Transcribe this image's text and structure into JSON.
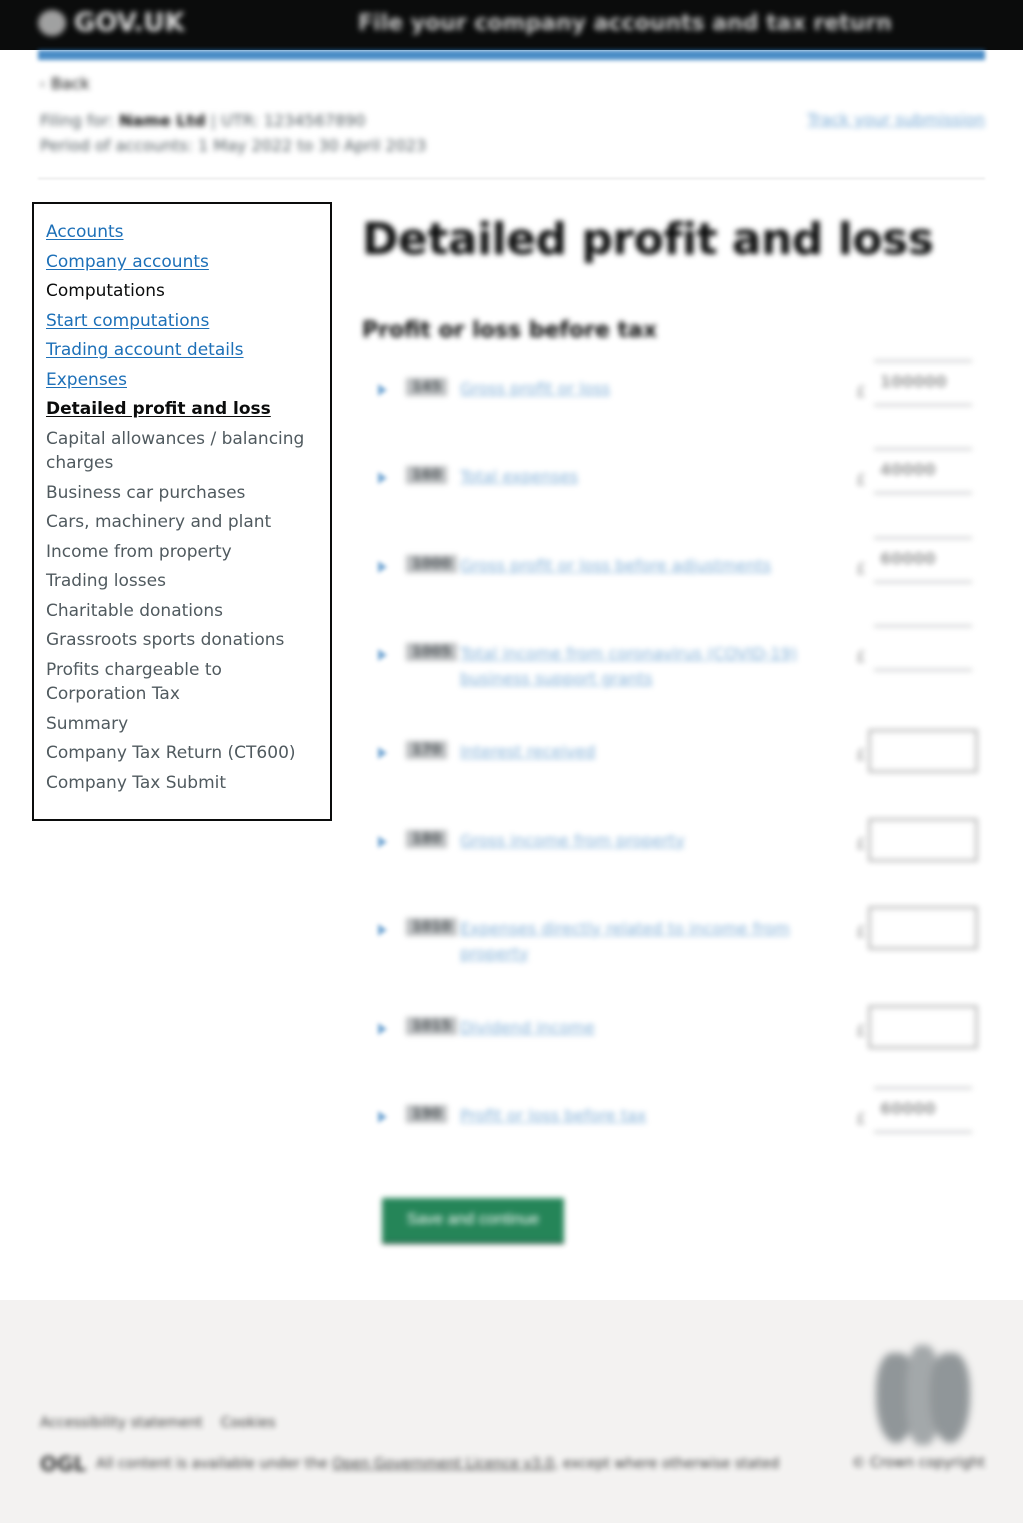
{
  "header": {
    "logo_text": "GOV.UK",
    "service_name": "File your company accounts and tax return"
  },
  "back_link": "Back",
  "meta": {
    "filing_for_label": "Filing for:",
    "company_name": "Name Ltd",
    "utr": "| UTR: 1234567890",
    "period": "Period of accounts: 1 May 2022 to 30 April 2023",
    "track_link": "Track your submission"
  },
  "sidebar": {
    "items": [
      {
        "label": "Accounts",
        "type": "link"
      },
      {
        "label": "Company accounts",
        "type": "link"
      },
      {
        "label": "Computations",
        "type": "heading"
      },
      {
        "label": "Start computations",
        "type": "link"
      },
      {
        "label": "Trading account details",
        "type": "link"
      },
      {
        "label": "Expenses",
        "type": "link"
      },
      {
        "label": "Detailed profit and loss",
        "type": "current"
      },
      {
        "label": "Capital allowances / balancing charges",
        "type": "disabled"
      },
      {
        "label": "Business car purchases",
        "type": "disabled"
      },
      {
        "label": "Cars, machinery and plant",
        "type": "disabled"
      },
      {
        "label": "Income from property",
        "type": "disabled"
      },
      {
        "label": "Trading losses",
        "type": "disabled"
      },
      {
        "label": "Charitable donations",
        "type": "disabled"
      },
      {
        "label": "Grassroots sports donations",
        "type": "disabled"
      },
      {
        "label": "Profits chargeable to Corporation Tax",
        "type": "disabled"
      },
      {
        "label": "Summary",
        "type": "disabled"
      },
      {
        "label": "Company Tax Return (CT600)",
        "type": "disabled"
      },
      {
        "label": "Company Tax Submit",
        "type": "disabled"
      }
    ]
  },
  "main": {
    "title": "Detailed profit and loss",
    "section_title": "Profit or loss before tax",
    "currency": "£",
    "rows": [
      {
        "box": "145",
        "label": "Gross profit or loss",
        "kind": "readonly",
        "value": "100000"
      },
      {
        "box": "160",
        "label": "Total expenses",
        "kind": "readonly",
        "value": "40000"
      },
      {
        "box": "1000",
        "label": "Gross profit or loss before adjustments",
        "kind": "readonly",
        "value": "60000"
      },
      {
        "box": "1005",
        "label": "Total income from coronavirus (COVID-19) business support grants",
        "kind": "readonly",
        "value": ""
      },
      {
        "box": "170",
        "label": "Interest received",
        "kind": "input",
        "value": ""
      },
      {
        "box": "180",
        "label": "Gross income from property",
        "kind": "input",
        "value": ""
      },
      {
        "box": "1010",
        "label": "Expenses directly related to income from property",
        "kind": "input",
        "value": ""
      },
      {
        "box": "1015",
        "label": "Dividend income",
        "kind": "input",
        "value": ""
      },
      {
        "box": "190",
        "label": "Profit or loss before tax",
        "kind": "readonly",
        "value": "60000"
      }
    ],
    "submit_label": "Save and continue"
  },
  "footer": {
    "links": [
      "Accessibility statement",
      "Cookies"
    ],
    "ogl_label": "OGL",
    "licence_prefix": "All content is available under the",
    "licence_link": "Open Government Licence v3.0",
    "licence_suffix": ", except where otherwise stated",
    "copyright": "© Crown copyright"
  },
  "colors": {
    "link": "#1d70b8",
    "header_bg": "#0b0c0c",
    "button": "#00703c",
    "footer_bg": "#f3f2f1"
  }
}
